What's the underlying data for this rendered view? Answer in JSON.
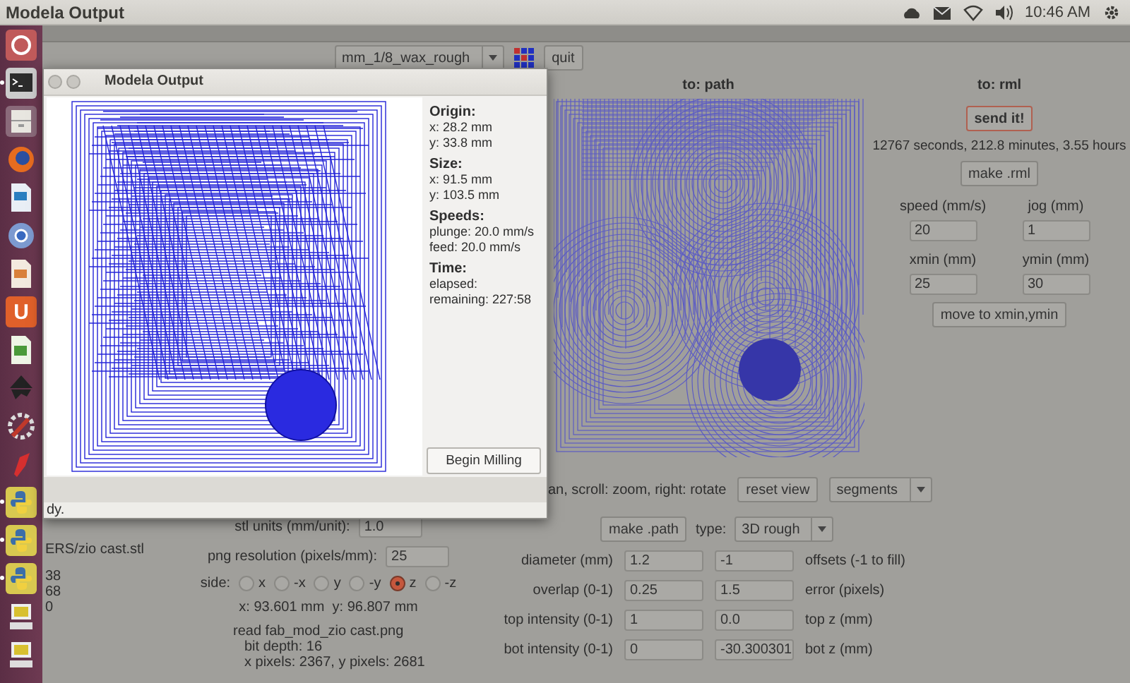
{
  "top_panel": {
    "title": "Modela Output",
    "clock": "10:46 AM"
  },
  "launcher": [
    {
      "kind": "home",
      "running": false
    },
    {
      "kind": "terminal",
      "running": true
    },
    {
      "kind": "files",
      "running": false
    },
    {
      "kind": "firefox",
      "running": false
    },
    {
      "kind": "writer",
      "running": false
    },
    {
      "kind": "chromium",
      "running": false
    },
    {
      "kind": "impress",
      "running": false
    },
    {
      "kind": "ubuntu-one",
      "glyph": "U",
      "running": false
    },
    {
      "kind": "calc",
      "running": false
    },
    {
      "kind": "inkscape",
      "running": false
    },
    {
      "kind": "settings",
      "running": false
    },
    {
      "kind": "red",
      "running": false
    },
    {
      "kind": "python",
      "running": true
    },
    {
      "kind": "python",
      "running": true
    },
    {
      "kind": "python",
      "running": true
    },
    {
      "kind": "screen",
      "running": false
    },
    {
      "kind": "screen",
      "running": false
    }
  ],
  "toolbar": {
    "machine": "mm_1/8_wax_rough",
    "quit": "quit"
  },
  "path_panel": {
    "title": "to: path"
  },
  "rml_panel": {
    "title": "to: rml",
    "send": "send it!",
    "estimate": "12767 seconds, 212.8 minutes, 3.55 hours",
    "make": "make .rml",
    "fields": [
      {
        "label": "speed (mm/s)",
        "value": "20"
      },
      {
        "label": "jog (mm)",
        "value": "1"
      },
      {
        "label": "xmin (mm)",
        "value": "25"
      },
      {
        "label": "ymin (mm)",
        "value": "30"
      }
    ],
    "move": "move to xmin,ymin"
  },
  "view_controls": {
    "hint": "an, scroll: zoom, right: rotate",
    "reset": "reset view",
    "mode": "segments"
  },
  "file_info": {
    "path": "ERS/zio cast.stl",
    "lines": [
      "38",
      "68",
      "0"
    ]
  },
  "input_settings": {
    "stl_units_label": "stl units (mm/unit):",
    "stl_units": "1.0",
    "png_res_label": "png resolution (pixels/mm):",
    "png_res": "25",
    "side_label": "side:",
    "sides": [
      {
        "label": "x",
        "selected": false
      },
      {
        "label": "-x",
        "selected": false
      },
      {
        "label": "y",
        "selected": false
      },
      {
        "label": "-y",
        "selected": false
      },
      {
        "label": "z",
        "selected": true
      },
      {
        "label": "-z",
        "selected": false
      }
    ],
    "dimensions": "x: 93.601 mm  y: 96.807 mm",
    "log": [
      "read fab_mod_zio cast.png",
      "bit depth: 16",
      "x pixels: 2367, y pixels: 2681"
    ]
  },
  "path_settings": {
    "make": "make .path",
    "type_label": "type:",
    "type": "3D rough",
    "rows": [
      {
        "label": "diameter (mm)",
        "value": "1.2",
        "value_2": "-1",
        "label_2": "offsets (-1 to fill)"
      },
      {
        "label": "overlap (0-1)",
        "value": "0.25",
        "value_2": "1.5",
        "label_2": "error (pixels)"
      },
      {
        "label": "top intensity (0-1)",
        "value": "1",
        "value_2": "0.0",
        "label_2": "top z (mm)"
      },
      {
        "label": "bot intensity (0-1)",
        "value": "0",
        "value_2": "-30.300301",
        "label_2": "bot z (mm)"
      }
    ]
  },
  "dialog": {
    "title": "Modela Output",
    "info": [
      {
        "heading": "Origin:",
        "lines": [
          "x: 28.2 mm",
          "y: 33.8 mm"
        ]
      },
      {
        "heading": "Size:",
        "lines": [
          "x: 91.5 mm",
          "y: 103.5 mm"
        ]
      },
      {
        "heading": "Speeds:",
        "lines": [
          "plunge: 20.0 mm/s",
          "feed: 20.0 mm/s"
        ]
      },
      {
        "heading": "Time:",
        "lines": [
          "elapsed:",
          "remaining: 227:58"
        ]
      }
    ],
    "button": "Begin Milling",
    "status": "dy."
  }
}
